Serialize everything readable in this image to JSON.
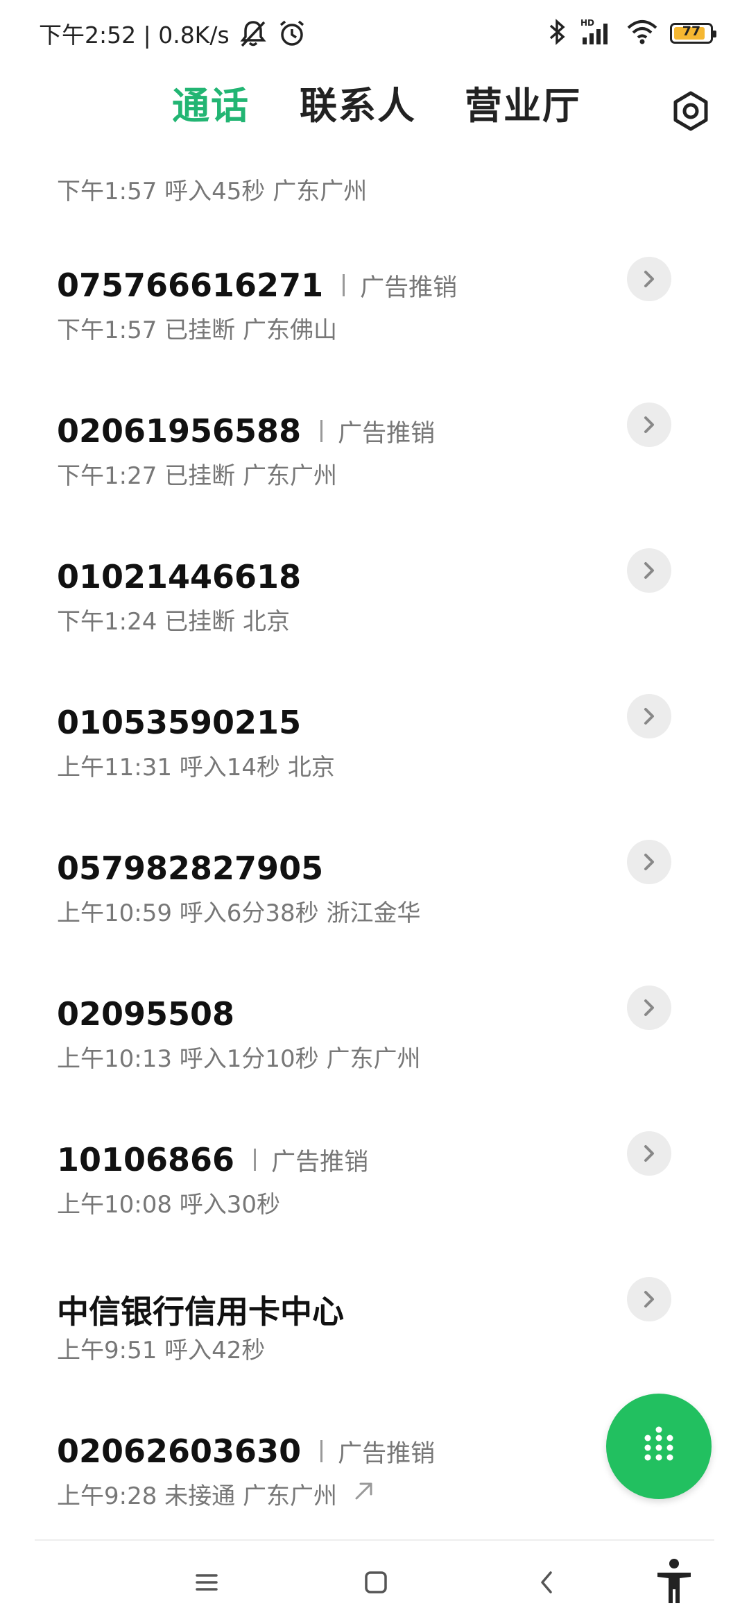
{
  "status_bar": {
    "time_speed": "下午2:52 | 0.8K/s",
    "icons": [
      "mute-notifications-icon",
      "alarm-icon",
      "bluetooth-icon",
      "hd-signal-icon",
      "wifi-icon"
    ],
    "battery": "77",
    "battery_color": "#f5b731"
  },
  "tabs": [
    {
      "label": "通话",
      "active": true
    },
    {
      "label": "联系人",
      "active": false
    },
    {
      "label": "营业厅",
      "active": false
    }
  ],
  "accent_color": "#22b573",
  "partial_item": {
    "detail": "下午1:57 呼入45秒 广东广州"
  },
  "calls": [
    {
      "number": "075766616271",
      "tag": "广告推销",
      "detail": "下午1:57 已挂断 广东佛山"
    },
    {
      "number": "02061956588",
      "tag": "广告推销",
      "detail": "下午1:27 已挂断 广东广州"
    },
    {
      "number": "01021446618",
      "tag": "",
      "detail": "下午1:24 已挂断 北京"
    },
    {
      "number": "01053590215",
      "tag": "",
      "detail": "上午11:31 呼入14秒 北京"
    },
    {
      "number": "057982827905",
      "tag": "",
      "detail": "上午10:59 呼入6分38秒 浙江金华"
    },
    {
      "number": "02095508",
      "tag": "",
      "detail": "上午10:13 呼入1分10秒 广东广州"
    },
    {
      "number": "10106866",
      "tag": "广告推销",
      "detail": "上午10:08 呼入30秒"
    },
    {
      "number": "中信银行信用卡中心",
      "tag": "",
      "detail": "上午9:51 呼入42秒"
    },
    {
      "number": "02062603630",
      "tag": "广告推销",
      "detail": "上午9:28 未接通 广东广州"
    }
  ],
  "fab": {
    "icon": "dialpad-icon",
    "color": "#22c060"
  },
  "navbar": {
    "icons": [
      "menu-icon",
      "home-icon",
      "back-icon",
      "accessibility-icon"
    ]
  }
}
